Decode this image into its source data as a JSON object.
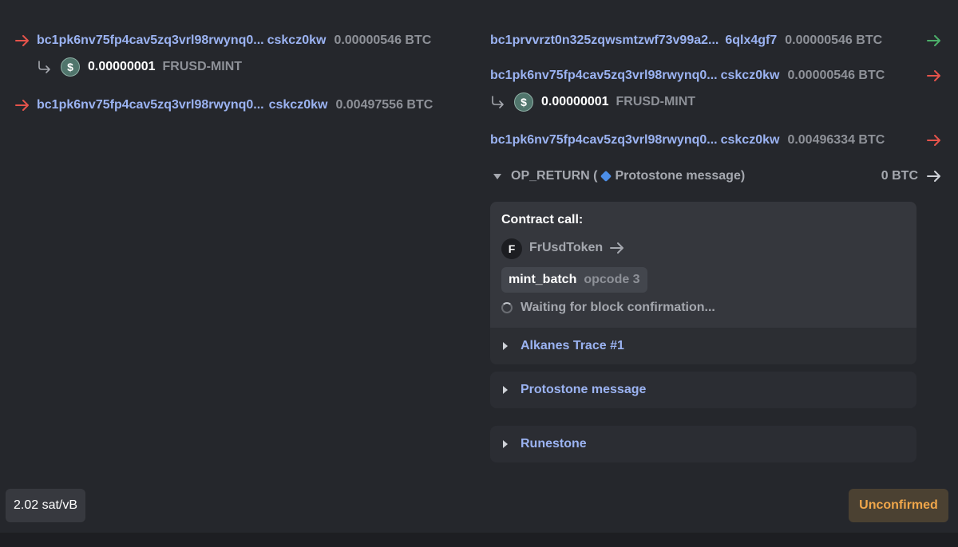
{
  "inputs": [
    {
      "address_start": "bc1pk6nv75fp4cav5zq3vrl98rwynq0...",
      "address_end": "cskcz0kw",
      "amount": "0.00000546 BTC",
      "token": {
        "icon": "$",
        "amount": "0.00000001",
        "name": "FRUSD-MINT"
      }
    },
    {
      "address_start": "bc1pk6nv75fp4cav5zq3vrl98rwynq0...",
      "address_end": "cskcz0kw",
      "amount": "0.00497556 BTC"
    }
  ],
  "outputs": [
    {
      "address_start": "bc1prvvrzt0n325zqwsmtzwf73v99a2...",
      "address_end": "6qlx4gf7",
      "amount": "0.00000546 BTC",
      "arrow_color": "#4caf6a"
    },
    {
      "address_start": "bc1pk6nv75fp4cav5zq3vrl98rwynq0...",
      "address_end": "cskcz0kw",
      "amount": "0.00000546 BTC",
      "arrow_color": "#e5534b",
      "token": {
        "icon": "$",
        "amount": "0.00000001",
        "name": "FRUSD-MINT"
      }
    },
    {
      "address_start": "bc1pk6nv75fp4cav5zq3vrl98rwynq0...",
      "address_end": "cskcz0kw",
      "amount": "0.00496334 BTC",
      "arrow_color": "#e5534b"
    }
  ],
  "op_return": {
    "label_prefix": "OP_RETURN (",
    "label_message": "Protostone message",
    "label_suffix": ")",
    "amount": "0 BTC"
  },
  "contract": {
    "title": "Contract call:",
    "badge": "F",
    "name": "FrUsdToken",
    "method": "mint_batch",
    "opcode": "opcode 3",
    "waiting": "Waiting for block confirmation..."
  },
  "sections": {
    "trace": "Alkanes Trace #1",
    "protostone": "Protostone message",
    "runestone": "Runestone"
  },
  "footer": {
    "fee": "2.02 sat/vB",
    "status": "Unconfirmed"
  },
  "colors": {
    "address": "#9bb3f2",
    "status": "#f0a64a",
    "arrow_red": "#e5534b",
    "arrow_green": "#4caf6a"
  }
}
